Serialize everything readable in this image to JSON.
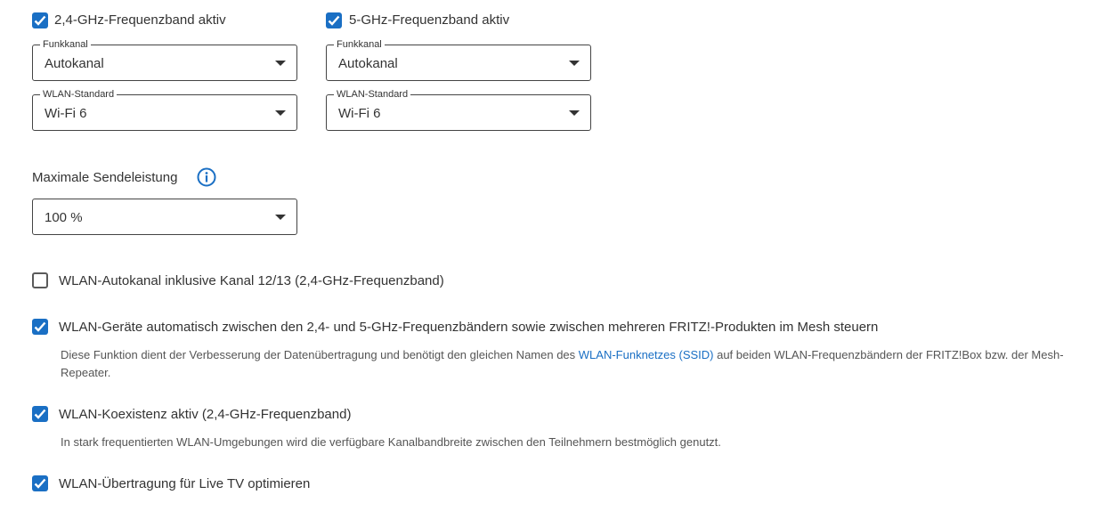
{
  "bands": {
    "band24": {
      "checkbox_label": "2,4-GHz-Frequenzband aktiv",
      "checked": true,
      "channel_legend": "Funkkanal",
      "channel_value": "Autokanal",
      "standard_legend": "WLAN-Standard",
      "standard_value": "Wi-Fi 6"
    },
    "band5": {
      "checkbox_label": "5-GHz-Frequenzband aktiv",
      "checked": true,
      "channel_legend": "Funkkanal",
      "channel_value": "Autokanal",
      "standard_legend": "WLAN-Standard",
      "standard_value": "Wi-Fi 6"
    }
  },
  "tx_power": {
    "label": "Maximale Sendeleistung",
    "value": "100 %",
    "info_icon": "info-circle-icon"
  },
  "options": {
    "autochannel_12_13": {
      "label": "WLAN-Autokanal inklusive Kanal 12/13 (2,4-GHz-Frequenzband)",
      "checked": false
    },
    "band_steering": {
      "label": "WLAN-Geräte automatisch zwischen den 2,4- und 5-GHz-Frequenzbändern sowie zwischen mehreren FRITZ!-Produkten im Mesh steuern",
      "checked": true,
      "desc_before": "Diese Funktion dient der Verbesserung der Datenübertragung und benötigt den gleichen Namen des ",
      "desc_link": "WLAN-Funknetzes (SSID)",
      "desc_after_line1": " auf beiden WLAN-Frequenzbändern der FRITZ!Box bzw. der Mesh-",
      "desc_line2": "Repeater."
    },
    "coexistence": {
      "label": "WLAN-Koexistenz aktiv (2,4-GHz-Frequenzband)",
      "checked": true,
      "desc": "In stark frequentierten WLAN-Umgebungen wird die verfügbare Kanalbandbreite zwischen den Teilnehmern bestmöglich genutzt."
    },
    "live_tv": {
      "label": "WLAN-Übertragung für Live TV optimieren",
      "checked": true
    }
  },
  "colors": {
    "accent": "#1a6fc4",
    "text": "#333333",
    "muted": "#555555"
  }
}
